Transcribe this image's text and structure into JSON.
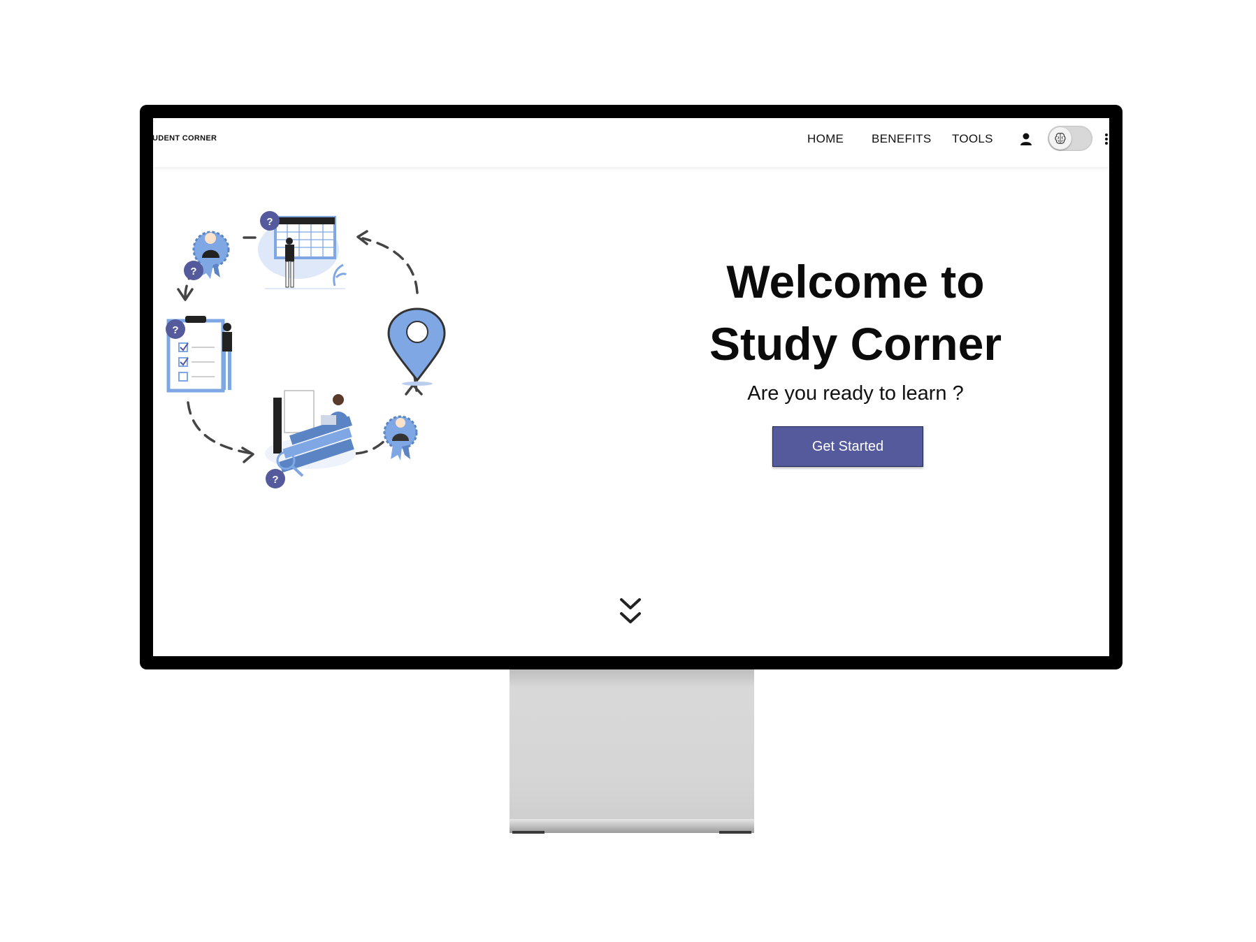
{
  "navbar": {
    "brand": "TUDENT CORNER",
    "links": [
      "HOME",
      "BENEFITS",
      "TOOLS"
    ],
    "icons": [
      "user-icon",
      "brain-icon",
      "more-vertical-icon"
    ]
  },
  "hero": {
    "title_line1": "Welcome to",
    "title_line2": "Study Corner",
    "subtitle": "Are you ready to learn ?",
    "cta_label": "Get Started",
    "scroll_icon": "double-chevron-down-icon"
  },
  "illustration": {
    "badge_text": "?"
  },
  "colors": {
    "accent": "#555a9c",
    "illustration_blue": "#7ea7e4",
    "badge": "#555a9c",
    "text": "#111111"
  }
}
